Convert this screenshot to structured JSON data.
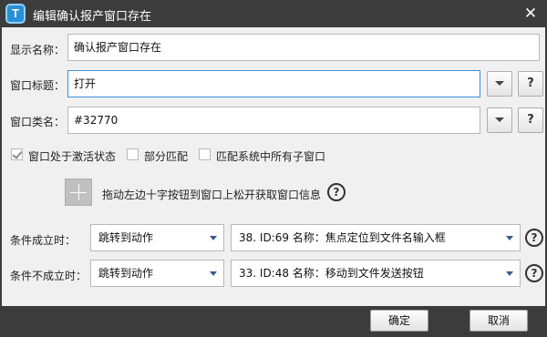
{
  "dialog": {
    "title": "编辑确认报产窗口存在",
    "app_icon_letter": "T",
    "close_symbol": "✕"
  },
  "form": {
    "display_name_label": "显示名称：",
    "display_name_value": "确认报产窗口存在",
    "window_title_label": "窗口标题：",
    "window_title_value": "打开",
    "window_class_label": "窗口类名：",
    "window_class_value": "#32770",
    "help_button_label": "?",
    "checkboxes": [
      {
        "label": "窗口处于激活状态",
        "checked": true
      },
      {
        "label": "部分匹配",
        "checked": false
      },
      {
        "label": "匹配系统中所有子窗口",
        "checked": false
      }
    ],
    "drag_hint": "拖动左边十字按钮到窗口上松开获取窗口信息",
    "help_circle_label": "?"
  },
  "conditions": {
    "true_label": "条件成立时：",
    "true_action": "跳转到动作",
    "true_target": "38. ID:69 名称：焦点定位到文件名输入框",
    "false_label": "条件不成立时：",
    "false_action": "跳转到动作",
    "false_target": "33. ID:48 名称：移动到文件发送按钮"
  },
  "footer": {
    "ok_label": "确定",
    "cancel_label": "取消"
  }
}
